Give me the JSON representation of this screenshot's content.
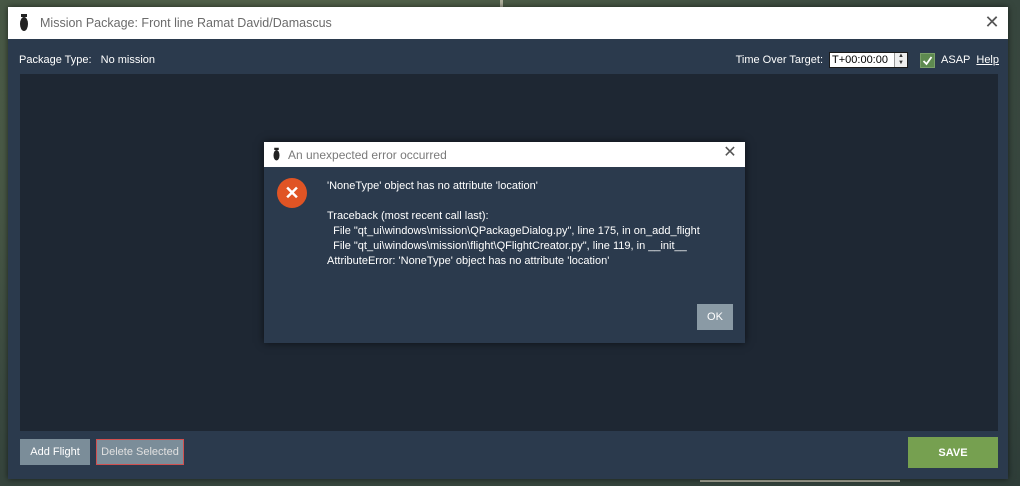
{
  "window": {
    "title": "Mission Package: Front line Ramat David/Damascus",
    "close_symbol": "✕"
  },
  "package": {
    "type_label": "Package Type:",
    "type_value": "No mission"
  },
  "time_over_target": {
    "label": "Time Over Target:",
    "value": "T+00:00:00",
    "asap_label": "ASAP",
    "asap_checked": true,
    "help_label": "Help"
  },
  "buttons": {
    "add_flight": "Add Flight",
    "delete_selected": "Delete Selected",
    "save": "SAVE"
  },
  "error_dialog": {
    "title": "An unexpected error occurred",
    "close_symbol": "✕",
    "message": "'NoneType' object has no attribute 'location'\n\nTraceback (most recent call last):\n  File \"qt_ui\\windows\\mission\\QPackageDialog.py\", line 175, in on_add_flight\n  File \"qt_ui\\windows\\mission\\flight\\QFlightCreator.py\", line 119, in __init__\nAttributeError: 'NoneType' object has no attribute 'location'",
    "ok_label": "OK",
    "icon": "error-x-icon"
  },
  "colors": {
    "accent_save": "#76a050",
    "error_icon": "#e05424",
    "dialog_bg": "#2b3a4d"
  }
}
